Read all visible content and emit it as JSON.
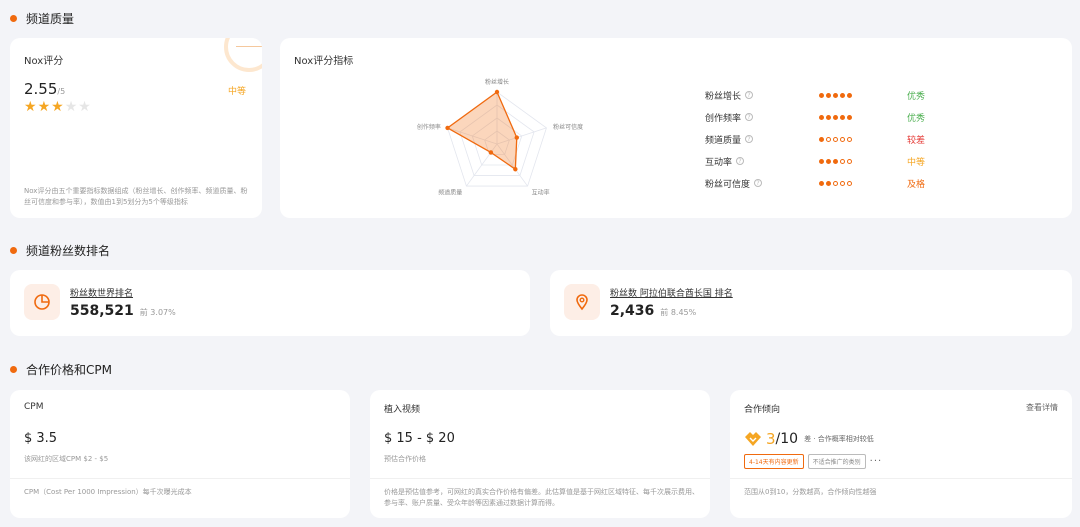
{
  "sections": {
    "quality": "频道质量",
    "ranking": "频道粉丝数排名",
    "pricing": "合作价格和CPM"
  },
  "score": {
    "label": "Nox评分",
    "value": "2.55",
    "max": "/5",
    "stars_filled": 3,
    "stars_total": 5,
    "grade": "中等",
    "note": "Nox评分由五个重要指标数据组成（粉丝增长、创作频率、频道质量、粉丝可信度和参与率），数值由1到5划分为5个等级指标"
  },
  "indicators": {
    "label": "Nox评分指标",
    "radar_axes": [
      "粉丝增长",
      "粉丝可信度",
      "互动率",
      "频道质量",
      "创作频率"
    ],
    "rows": [
      {
        "name": "粉丝增长",
        "level": 5,
        "status": "优秀",
        "color": "#4caf50"
      },
      {
        "name": "创作频率",
        "level": 5,
        "status": "优秀",
        "color": "#4caf50"
      },
      {
        "name": "频道质量",
        "level": 1,
        "status": "较差",
        "color": "#e53935"
      },
      {
        "name": "互动率",
        "level": 3,
        "status": "中等",
        "color": "#f5a623"
      },
      {
        "name": "粉丝可信度",
        "level": 2,
        "status": "及格",
        "color": "#f06a0f"
      }
    ]
  },
  "ranking": {
    "world": {
      "link": "粉丝数世界排名",
      "number": "558,521",
      "top": "前 3.07%"
    },
    "country": {
      "link": "粉丝数 阿拉伯联合酋长国 排名",
      "number": "2,436",
      "top": "前 8.45%"
    }
  },
  "pricing": {
    "cpm": {
      "label": "CPM",
      "value": "$ 3.5",
      "sub": "该网红的区域CPM $2 - $5",
      "note": "CPM（Cost Per 1000 Impression）每千次曝光成本"
    },
    "video": {
      "label": "植入视频",
      "value": "$ 15 - $ 20",
      "sub": "预估合作价格",
      "note": "价格是预估值参考，可网红的真实合作价格有偏差。此估算值是基于网红区域特征、每千次展示费用、参与率、账户质量、受众年龄等因素通过数据计算而得。"
    },
    "coop": {
      "label": "合作倾向",
      "detail": "查看详情",
      "score": "3",
      "max": "/10",
      "desc": "差 · 合作概率相对较低",
      "tag1": "4-14天有内容更新",
      "tag2": "不适合推广的类别",
      "more": "···",
      "note": "范围从0到10，分数越高，合作倾向性越强"
    }
  },
  "colors": {
    "accent": "#f06a0f",
    "star": "#f5a623"
  }
}
